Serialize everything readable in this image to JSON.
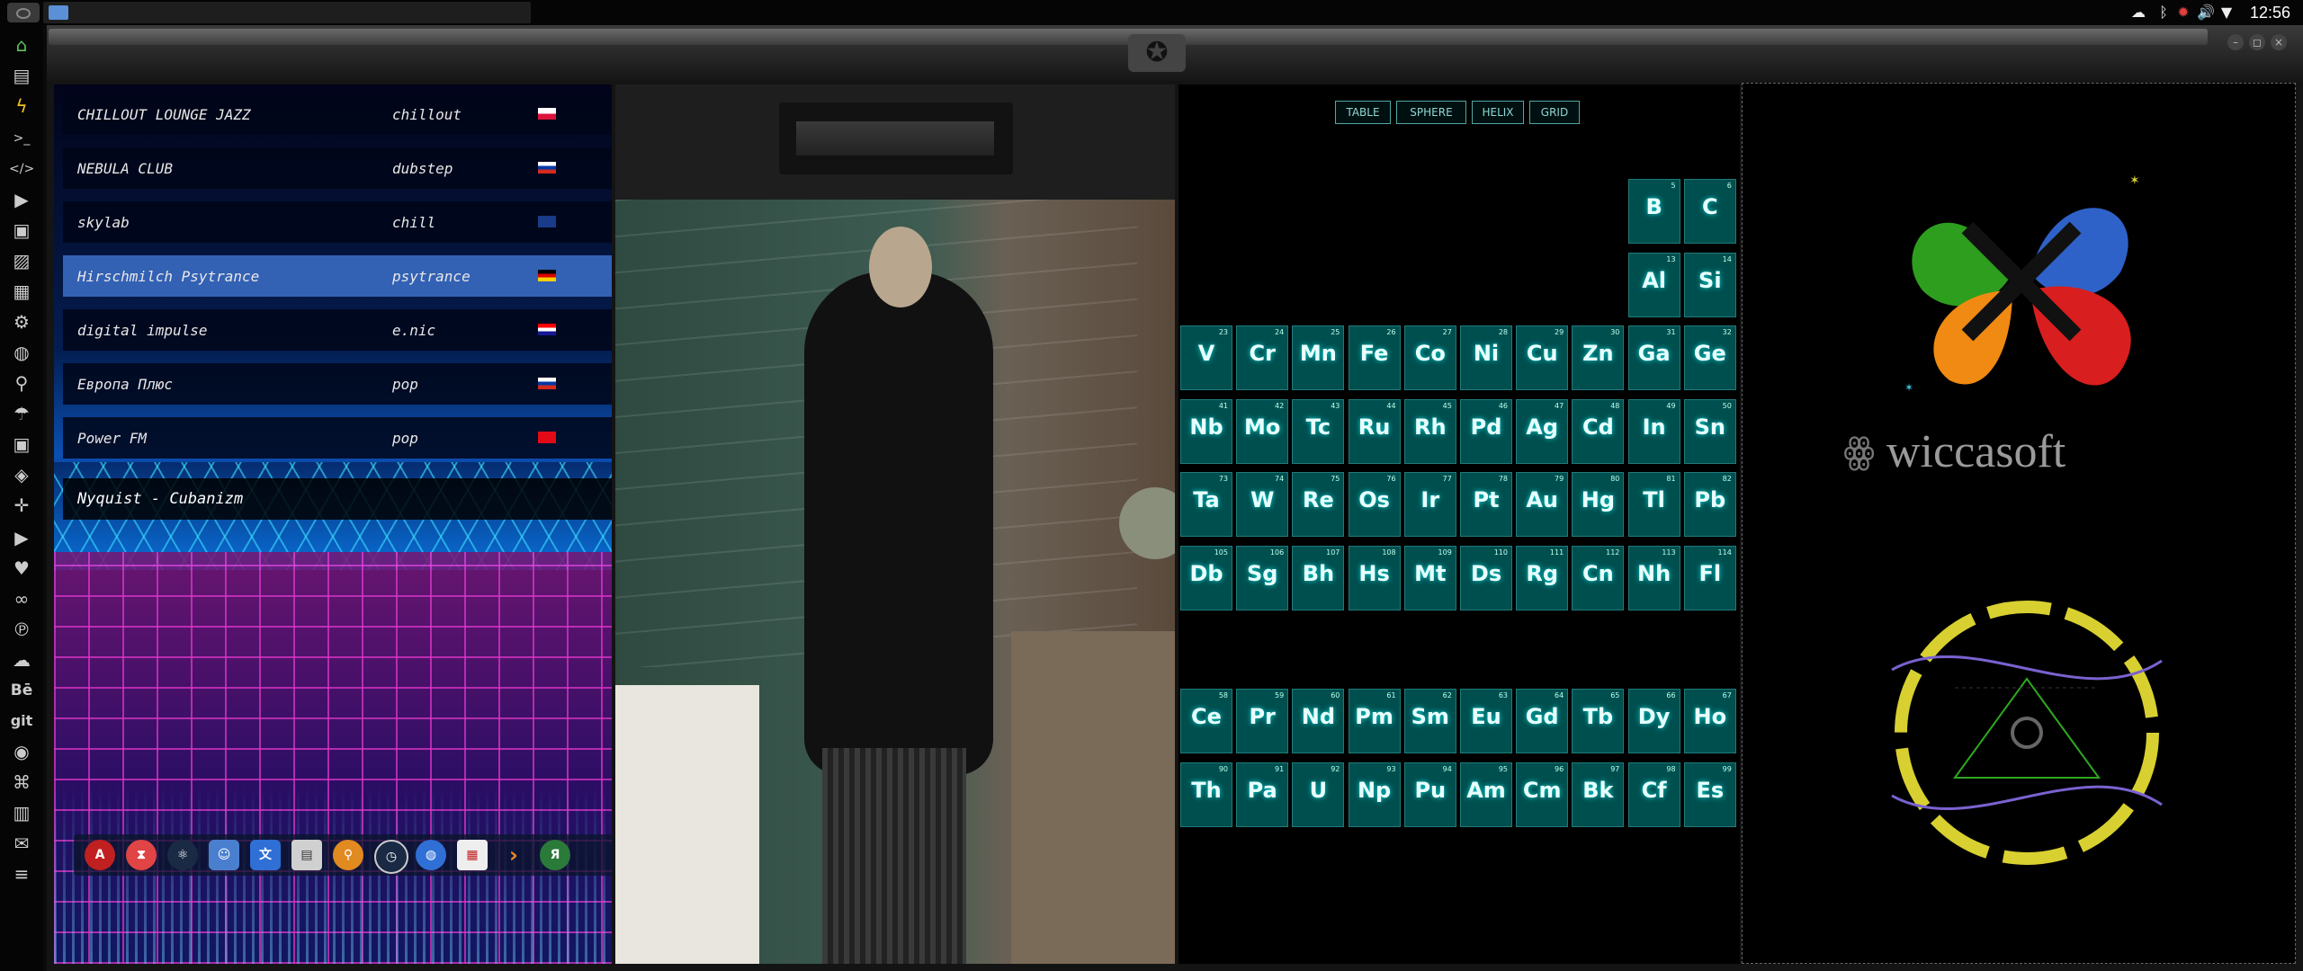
{
  "top_panel": {
    "clock": "12:56",
    "tray_icons": [
      "cloud-icon",
      "bluetooth-icon",
      "update-icon",
      "volume-icon",
      "wifi-icon"
    ]
  },
  "side_dock": {
    "items": [
      "home-icon",
      "document-icon",
      "bolt-icon",
      "terminal-icon",
      "code-icon",
      "play-icon",
      "movie-icon",
      "image-icon",
      "news-icon",
      "settings-icon",
      "globe-icon",
      "search-icon",
      "umbrella-icon",
      "contacts-icon",
      "tags-icon",
      "crosshair-icon",
      "youtube-icon",
      "heart-icon",
      "infinity-icon",
      "pinterest-icon",
      "cloud-icon",
      "behance-icon",
      "git-icon",
      "github-icon",
      "graph-icon",
      "map-icon",
      "mail-icon",
      "tray-icon"
    ],
    "labels": {
      "behance": "Bē",
      "git": "git"
    }
  },
  "radio": {
    "stations": [
      {
        "name": "CHILLOUT LOUNGE JAZZ",
        "genre": "chillout",
        "flag": "pl",
        "active": false
      },
      {
        "name": "NEBULA CLUB",
        "genre": "dubstep",
        "flag": "ru",
        "active": false
      },
      {
        "name": "skylab",
        "genre": "chill",
        "flag": "gb",
        "active": false
      },
      {
        "name": "Hirschmilch Psytrance",
        "genre": "psytrance",
        "flag": "de",
        "active": true
      },
      {
        "name": "digital impulse",
        "genre": "e.nic",
        "flag": "hr",
        "active": false
      },
      {
        "name": "Европа Плюс",
        "genre": "pop",
        "flag": "ru",
        "active": false
      },
      {
        "name": "Power FM",
        "genre": "pop",
        "flag": "tr",
        "active": false
      }
    ],
    "now_playing": "Nyquist - Cubanizm"
  },
  "bottom_dock": {
    "apps": [
      "adobe-icon",
      "hourglass-icon",
      "atom-icon",
      "finder-icon",
      "translate-icon",
      "terminal-icon",
      "search-icon",
      "clock-icon",
      "globe-icon",
      "calendar-icon",
      "play-icon",
      "yandex-icon"
    ],
    "yandex_label": "Я"
  },
  "ptable": {
    "view_buttons": [
      "TABLE",
      "SPHERE",
      "HELIX",
      "GRID"
    ],
    "rows": [
      [
        {
          "n": "5",
          "s": "B",
          "c": 8
        },
        {
          "n": "6",
          "s": "C",
          "c": 9
        }
      ],
      [
        {
          "n": "13",
          "s": "Al",
          "c": 8
        },
        {
          "n": "14",
          "s": "Si",
          "c": 9
        }
      ],
      [
        {
          "n": "23",
          "s": "V",
          "c": 0
        },
        {
          "n": "24",
          "s": "Cr",
          "c": 1
        },
        {
          "n": "25",
          "s": "Mn",
          "c": 2
        },
        {
          "n": "26",
          "s": "Fe",
          "c": 3
        },
        {
          "n": "27",
          "s": "Co",
          "c": 4
        },
        {
          "n": "28",
          "s": "Ni",
          "c": 5
        },
        {
          "n": "29",
          "s": "Cu",
          "c": 6
        },
        {
          "n": "30",
          "s": "Zn",
          "c": 7
        },
        {
          "n": "31",
          "s": "Ga",
          "c": 8
        },
        {
          "n": "32",
          "s": "Ge",
          "c": 9
        }
      ],
      [
        {
          "n": "41",
          "s": "Nb",
          "c": 0
        },
        {
          "n": "42",
          "s": "Mo",
          "c": 1
        },
        {
          "n": "43",
          "s": "Tc",
          "c": 2
        },
        {
          "n": "44",
          "s": "Ru",
          "c": 3
        },
        {
          "n": "45",
          "s": "Rh",
          "c": 4
        },
        {
          "n": "46",
          "s": "Pd",
          "c": 5
        },
        {
          "n": "47",
          "s": "Ag",
          "c": 6
        },
        {
          "n": "48",
          "s": "Cd",
          "c": 7
        },
        {
          "n": "49",
          "s": "In",
          "c": 8
        },
        {
          "n": "50",
          "s": "Sn",
          "c": 9
        }
      ],
      [
        {
          "n": "73",
          "s": "Ta",
          "c": 0
        },
        {
          "n": "74",
          "s": "W",
          "c": 1
        },
        {
          "n": "75",
          "s": "Re",
          "c": 2
        },
        {
          "n": "76",
          "s": "Os",
          "c": 3
        },
        {
          "n": "77",
          "s": "Ir",
          "c": 4
        },
        {
          "n": "78",
          "s": "Pt",
          "c": 5
        },
        {
          "n": "79",
          "s": "Au",
          "c": 6
        },
        {
          "n": "80",
          "s": "Hg",
          "c": 7
        },
        {
          "n": "81",
          "s": "Tl",
          "c": 8
        },
        {
          "n": "82",
          "s": "Pb",
          "c": 9
        }
      ],
      [
        {
          "n": "105",
          "s": "Db",
          "c": 0
        },
        {
          "n": "106",
          "s": "Sg",
          "c": 1
        },
        {
          "n": "107",
          "s": "Bh",
          "c": 2
        },
        {
          "n": "108",
          "s": "Hs",
          "c": 3
        },
        {
          "n": "109",
          "s": "Mt",
          "c": 4
        },
        {
          "n": "110",
          "s": "Ds",
          "c": 5
        },
        {
          "n": "111",
          "s": "Rg",
          "c": 6
        },
        {
          "n": "112",
          "s": "Cn",
          "c": 7
        },
        {
          "n": "113",
          "s": "Nh",
          "c": 8
        },
        {
          "n": "114",
          "s": "Fl",
          "c": 9
        }
      ],
      [
        {
          "n": "58",
          "s": "Ce",
          "c": 0
        },
        {
          "n": "59",
          "s": "Pr",
          "c": 1
        },
        {
          "n": "60",
          "s": "Nd",
          "c": 2
        },
        {
          "n": "61",
          "s": "Pm",
          "c": 3
        },
        {
          "n": "62",
          "s": "Sm",
          "c": 4
        },
        {
          "n": "63",
          "s": "Eu",
          "c": 5
        },
        {
          "n": "64",
          "s": "Gd",
          "c": 6
        },
        {
          "n": "65",
          "s": "Tb",
          "c": 7
        },
        {
          "n": "66",
          "s": "Dy",
          "c": 8
        },
        {
          "n": "67",
          "s": "Ho",
          "c": 9
        }
      ],
      [
        {
          "n": "90",
          "s": "Th",
          "c": 0
        },
        {
          "n": "91",
          "s": "Pa",
          "c": 1
        },
        {
          "n": "92",
          "s": "U",
          "c": 2
        },
        {
          "n": "93",
          "s": "Np",
          "c": 3
        },
        {
          "n": "94",
          "s": "Pu",
          "c": 4
        },
        {
          "n": "95",
          "s": "Am",
          "c": 5
        },
        {
          "n": "96",
          "s": "Cm",
          "c": 6
        },
        {
          "n": "97",
          "s": "Bk",
          "c": 7
        },
        {
          "n": "98",
          "s": "Cf",
          "c": 8
        },
        {
          "n": "99",
          "s": "Es",
          "c": 9
        }
      ]
    ],
    "colors": {
      "tile": "#008080",
      "glow": "#7fffff"
    }
  },
  "wiccasoft": {
    "brand": "wiccasoft",
    "colors": {
      "green": "#2e9e1f",
      "blue": "#2f62c8",
      "orange": "#f08a12",
      "red": "#d81e1e",
      "ring": "#d8d030",
      "purple": "#7a62d0"
    }
  }
}
